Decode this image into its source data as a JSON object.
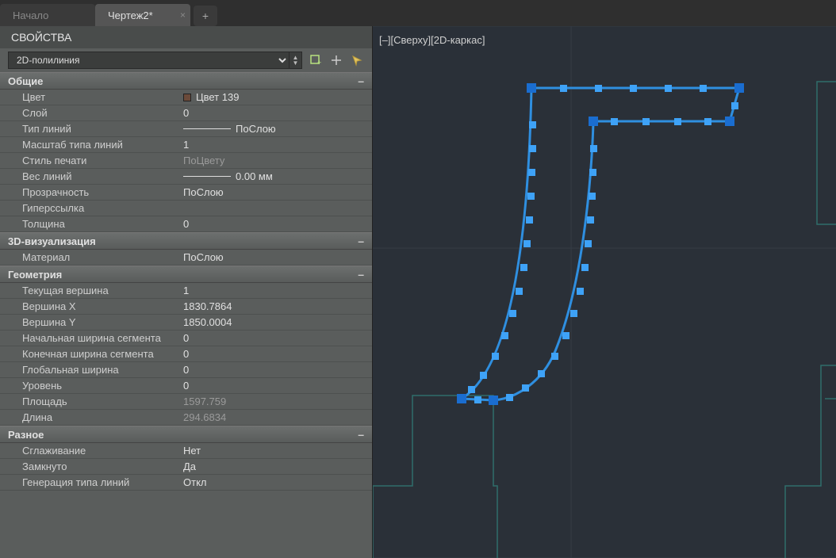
{
  "tabs": {
    "items": [
      {
        "label": "Начало",
        "active": false
      },
      {
        "label": "Чертеж2*",
        "active": true
      }
    ]
  },
  "panel": {
    "title": "СВОЙСТВА",
    "selector_value": "2D-полилиния"
  },
  "sections": {
    "general": {
      "title": "Общие",
      "rows": {
        "color": {
          "label": "Цвет",
          "value": "Цвет 139",
          "swatch": "#6b4a3a"
        },
        "layer": {
          "label": "Слой",
          "value": "0"
        },
        "linetype": {
          "label": "Тип линий",
          "value": "ПоСлою"
        },
        "ltscale": {
          "label": "Масштаб типа линий",
          "value": "1"
        },
        "plotstyle": {
          "label": "Стиль печати",
          "value": "ПоЦвету"
        },
        "lineweight": {
          "label": "Вес линий",
          "value": "0.00 мм"
        },
        "transparency": {
          "label": "Прозрачность",
          "value": "ПоСлою"
        },
        "hyperlink": {
          "label": "Гиперссылка",
          "value": ""
        },
        "thickness": {
          "label": "Толщина",
          "value": "0"
        }
      }
    },
    "visual3d": {
      "title": "3D-визуализация",
      "rows": {
        "material": {
          "label": "Материал",
          "value": "ПоСлою"
        }
      }
    },
    "geometry": {
      "title": "Геометрия",
      "rows": {
        "curvert": {
          "label": "Текущая вершина",
          "value": "1"
        },
        "vx": {
          "label": "Вершина X",
          "value": "1830.7864"
        },
        "vy": {
          "label": "Вершина Y",
          "value": "1850.0004"
        },
        "sw": {
          "label": "Начальная ширина сегмента",
          "value": "0"
        },
        "ew": {
          "label": "Конечная ширина сегмента",
          "value": "0"
        },
        "gw": {
          "label": "Глобальная ширина",
          "value": "0"
        },
        "elev": {
          "label": "Уровень",
          "value": "0"
        },
        "area": {
          "label": "Площадь",
          "value": "1597.759"
        },
        "length": {
          "label": "Длина",
          "value": "294.6834"
        }
      }
    },
    "misc": {
      "title": "Разное",
      "rows": {
        "smooth": {
          "label": "Сглаживание",
          "value": "Нет"
        },
        "closed": {
          "label": "Замкнуто",
          "value": "Да"
        },
        "ltgen": {
          "label": "Генерация типа линий",
          "value": "Откл"
        }
      }
    }
  },
  "viewport": {
    "label": "[–][Сверху][2D-каркас]"
  }
}
